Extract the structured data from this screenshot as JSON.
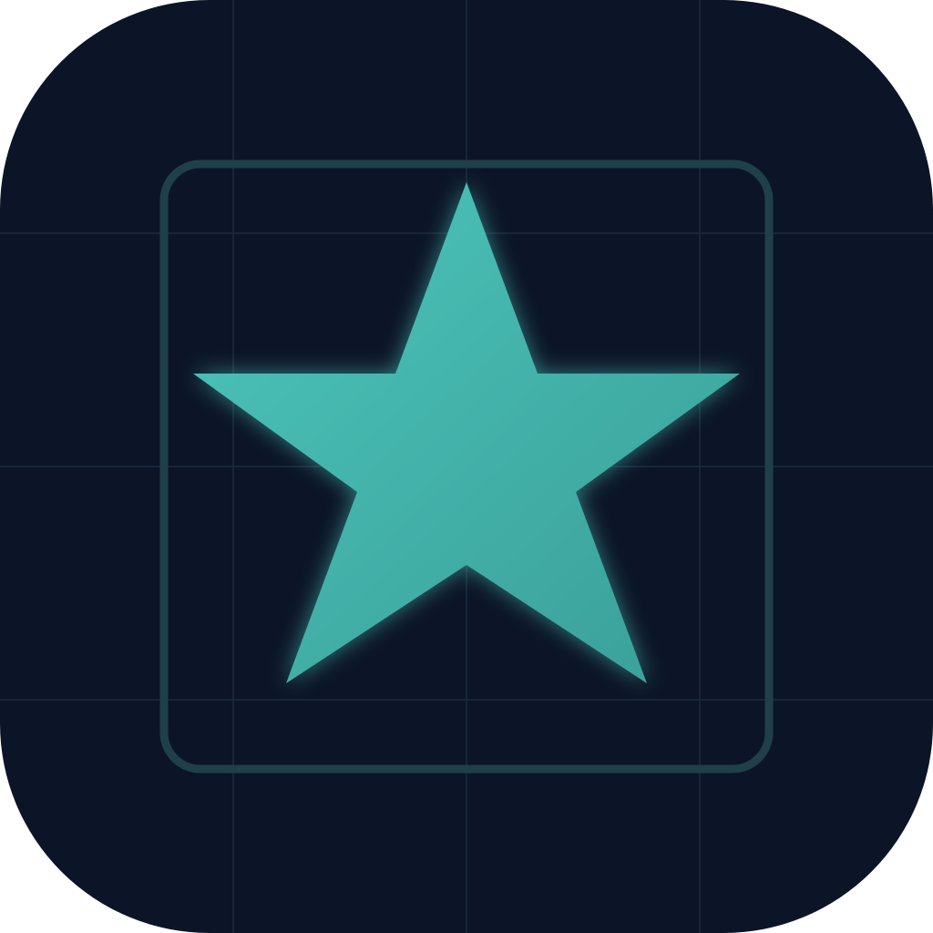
{
  "icon": {
    "name": "star",
    "colors": {
      "background": "#0c1527",
      "grid_line": "#17263a",
      "frame_stroke": "#1f4048",
      "star_light": "#4cc6bb",
      "star_dark": "#3a9e98",
      "glow": "#4fd6c8"
    },
    "grid_visible": true,
    "frame_visible": true
  }
}
